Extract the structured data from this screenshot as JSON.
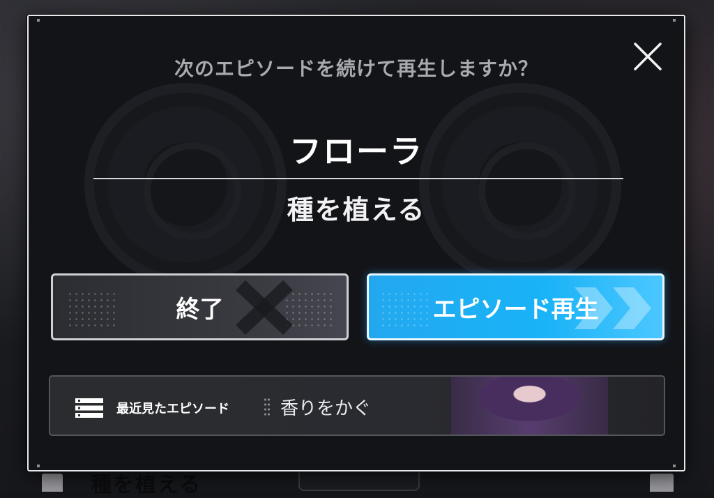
{
  "dialog": {
    "question": "次のエピソードを続けて再生しますか？",
    "character_name": "フローラ",
    "episode_title": "種を植える",
    "close_icon": "close-icon"
  },
  "buttons": {
    "end_label": "終了",
    "play_label": "エピソード再生"
  },
  "recent": {
    "label": "最近見たエピソード",
    "episode": "香りをかぐ",
    "icon": "list-icon"
  },
  "background": {
    "ghost_text": "種を植える"
  },
  "colors": {
    "accent": "#19b3f7",
    "modal_bg": "#131418",
    "modal_border": "#e9e9ec"
  }
}
